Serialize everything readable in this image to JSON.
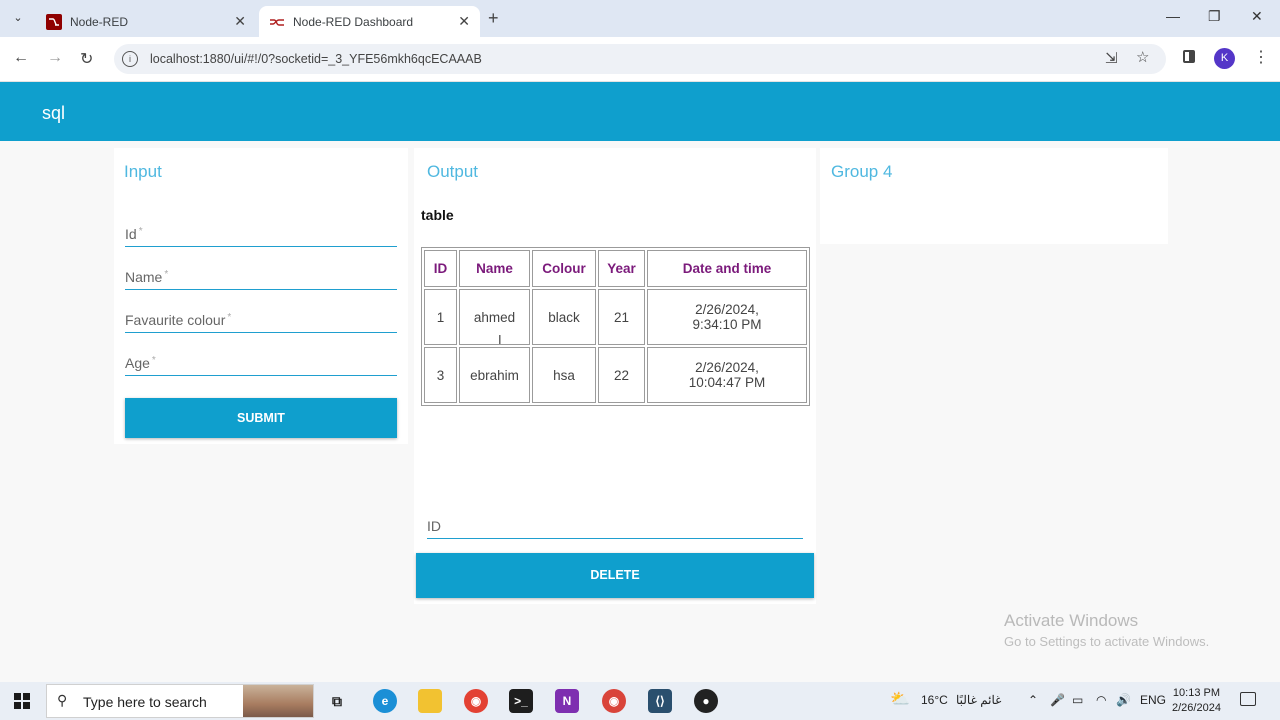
{
  "browser": {
    "tabs": [
      {
        "title": "Node-RED",
        "active": false
      },
      {
        "title": "Node-RED Dashboard",
        "active": true
      }
    ],
    "url": "localhost:1880/ui/#!/0?socketid=_3_YFE56mkh6qcECAAAB",
    "profile_initial": "K"
  },
  "dashboard": {
    "title": "sql",
    "accent_color": "#0f9fcd",
    "input_group": {
      "title": "Input",
      "fields": [
        {
          "label": "Id",
          "required_mark": "*"
        },
        {
          "label": "Name",
          "required_mark": "*"
        },
        {
          "label": "Favaurite colour",
          "required_mark": "*"
        },
        {
          "label": "Age",
          "required_mark": "*"
        }
      ],
      "submit_label": "SUBMIT"
    },
    "output_group": {
      "title": "Output",
      "table_label": "table",
      "columns": [
        "ID",
        "Name",
        "Colour",
        "Year",
        "Date and time"
      ],
      "rows": [
        {
          "id": "1",
          "name": "ahmed",
          "colour": "black",
          "year": "21",
          "date": "2/26/2024,",
          "time": "9:34:10 PM"
        },
        {
          "id": "3",
          "name": "ebrahim",
          "colour": "hsa",
          "year": "22",
          "date": "2/26/2024,",
          "time": "10:04:47 PM"
        }
      ],
      "id_field_label": "ID",
      "delete_label": "DELETE"
    },
    "group4": {
      "title": "Group 4"
    }
  },
  "watermark": {
    "line1": "Activate Windows",
    "line2": "Go to Settings to activate Windows."
  },
  "taskbar": {
    "search_placeholder": "Type here to search",
    "weather": "16°C",
    "weather_desc": "غائم غالبًا",
    "language": "ENG",
    "time": "10:13 PM",
    "date": "2/26/2024"
  }
}
